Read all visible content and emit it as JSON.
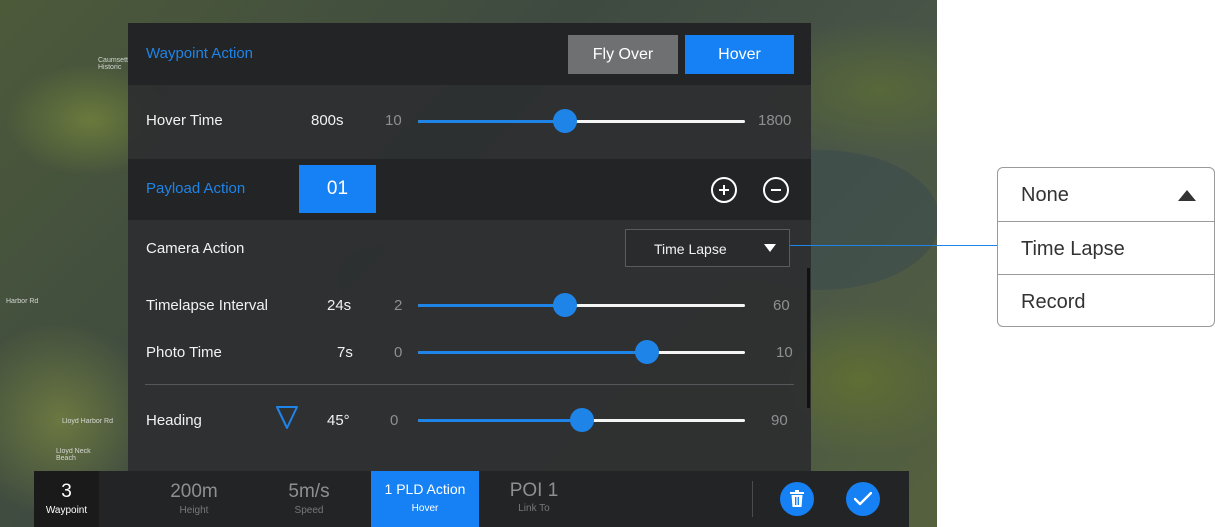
{
  "map": {
    "labels": [
      "Caumsett Historic",
      "Lloyd Harbor Rd",
      "Lloyd Harbor Rd",
      "Lloyd Neck Beach",
      "Harbor Rd"
    ]
  },
  "waypoint_action": {
    "title": "Waypoint Action",
    "fly_over_label": "Fly Over",
    "hover_label": "Hover",
    "selected": "Hover"
  },
  "hover_time": {
    "label": "Hover Time",
    "value": "800s",
    "min": "10",
    "max": "1800",
    "level": 0.45
  },
  "payload_action": {
    "title": "Payload Action",
    "index": "01",
    "add_icon": "plus-circle-icon",
    "remove_icon": "minus-circle-icon"
  },
  "camera_action": {
    "label": "Camera Action",
    "selected": "Time Lapse",
    "arrow_icon": "triangle-down-icon"
  },
  "timelapse_interval": {
    "label": "Timelapse Interval",
    "value": "24s",
    "min": "2",
    "max": "60",
    "level": 0.45
  },
  "photo_time": {
    "label": "Photo Time",
    "value": "7s",
    "min": "0",
    "max": "10",
    "level": 0.7
  },
  "heading": {
    "label": "Heading",
    "value": "45°",
    "min": "0",
    "max": "90",
    "level": 0.5,
    "icon": "heading-wedge-icon"
  },
  "bottom_bar": {
    "waypoint": {
      "value": "3",
      "label": "Waypoint"
    },
    "height": {
      "value": "200m",
      "label": "Height"
    },
    "speed": {
      "value": "5m/s",
      "label": "Speed"
    },
    "pld_action": {
      "value": "1 PLD Action",
      "label": "Hover"
    },
    "poi": {
      "value": "POI 1",
      "label": "Link To"
    },
    "delete_icon": "trash-icon",
    "confirm_icon": "check-icon"
  },
  "popup": {
    "options": [
      "None",
      "Time Lapse",
      "Record"
    ],
    "arrow_icon": "triangle-up-icon"
  },
  "colors": {
    "accent": "#1f84e8",
    "panel": "#2c2e30",
    "header": "#232425",
    "inactive_button": "#6f7072"
  }
}
